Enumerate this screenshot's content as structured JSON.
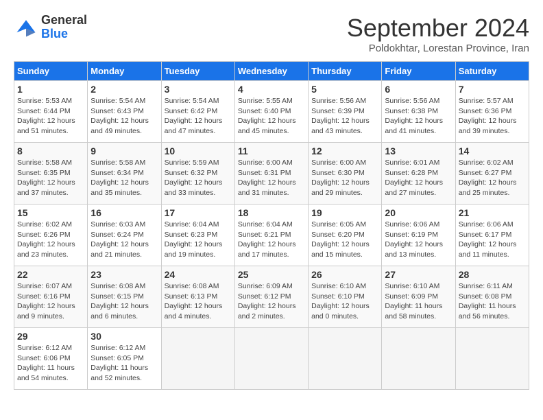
{
  "logo": {
    "text_general": "General",
    "text_blue": "Blue"
  },
  "header": {
    "month": "September 2024",
    "location": "Poldokhtar, Lorestan Province, Iran"
  },
  "weekdays": [
    "Sunday",
    "Monday",
    "Tuesday",
    "Wednesday",
    "Thursday",
    "Friday",
    "Saturday"
  ],
  "weeks": [
    [
      {
        "day": "1",
        "sunrise": "5:53 AM",
        "sunset": "6:44 PM",
        "daylight": "12 hours and 51 minutes."
      },
      {
        "day": "2",
        "sunrise": "5:54 AM",
        "sunset": "6:43 PM",
        "daylight": "12 hours and 49 minutes."
      },
      {
        "day": "3",
        "sunrise": "5:54 AM",
        "sunset": "6:42 PM",
        "daylight": "12 hours and 47 minutes."
      },
      {
        "day": "4",
        "sunrise": "5:55 AM",
        "sunset": "6:40 PM",
        "daylight": "12 hours and 45 minutes."
      },
      {
        "day": "5",
        "sunrise": "5:56 AM",
        "sunset": "6:39 PM",
        "daylight": "12 hours and 43 minutes."
      },
      {
        "day": "6",
        "sunrise": "5:56 AM",
        "sunset": "6:38 PM",
        "daylight": "12 hours and 41 minutes."
      },
      {
        "day": "7",
        "sunrise": "5:57 AM",
        "sunset": "6:36 PM",
        "daylight": "12 hours and 39 minutes."
      }
    ],
    [
      {
        "day": "8",
        "sunrise": "5:58 AM",
        "sunset": "6:35 PM",
        "daylight": "12 hours and 37 minutes."
      },
      {
        "day": "9",
        "sunrise": "5:58 AM",
        "sunset": "6:34 PM",
        "daylight": "12 hours and 35 minutes."
      },
      {
        "day": "10",
        "sunrise": "5:59 AM",
        "sunset": "6:32 PM",
        "daylight": "12 hours and 33 minutes."
      },
      {
        "day": "11",
        "sunrise": "6:00 AM",
        "sunset": "6:31 PM",
        "daylight": "12 hours and 31 minutes."
      },
      {
        "day": "12",
        "sunrise": "6:00 AM",
        "sunset": "6:30 PM",
        "daylight": "12 hours and 29 minutes."
      },
      {
        "day": "13",
        "sunrise": "6:01 AM",
        "sunset": "6:28 PM",
        "daylight": "12 hours and 27 minutes."
      },
      {
        "day": "14",
        "sunrise": "6:02 AM",
        "sunset": "6:27 PM",
        "daylight": "12 hours and 25 minutes."
      }
    ],
    [
      {
        "day": "15",
        "sunrise": "6:02 AM",
        "sunset": "6:26 PM",
        "daylight": "12 hours and 23 minutes."
      },
      {
        "day": "16",
        "sunrise": "6:03 AM",
        "sunset": "6:24 PM",
        "daylight": "12 hours and 21 minutes."
      },
      {
        "day": "17",
        "sunrise": "6:04 AM",
        "sunset": "6:23 PM",
        "daylight": "12 hours and 19 minutes."
      },
      {
        "day": "18",
        "sunrise": "6:04 AM",
        "sunset": "6:21 PM",
        "daylight": "12 hours and 17 minutes."
      },
      {
        "day": "19",
        "sunrise": "6:05 AM",
        "sunset": "6:20 PM",
        "daylight": "12 hours and 15 minutes."
      },
      {
        "day": "20",
        "sunrise": "6:06 AM",
        "sunset": "6:19 PM",
        "daylight": "12 hours and 13 minutes."
      },
      {
        "day": "21",
        "sunrise": "6:06 AM",
        "sunset": "6:17 PM",
        "daylight": "12 hours and 11 minutes."
      }
    ],
    [
      {
        "day": "22",
        "sunrise": "6:07 AM",
        "sunset": "6:16 PM",
        "daylight": "12 hours and 9 minutes."
      },
      {
        "day": "23",
        "sunrise": "6:08 AM",
        "sunset": "6:15 PM",
        "daylight": "12 hours and 6 minutes."
      },
      {
        "day": "24",
        "sunrise": "6:08 AM",
        "sunset": "6:13 PM",
        "daylight": "12 hours and 4 minutes."
      },
      {
        "day": "25",
        "sunrise": "6:09 AM",
        "sunset": "6:12 PM",
        "daylight": "12 hours and 2 minutes."
      },
      {
        "day": "26",
        "sunrise": "6:10 AM",
        "sunset": "6:10 PM",
        "daylight": "12 hours and 0 minutes."
      },
      {
        "day": "27",
        "sunrise": "6:10 AM",
        "sunset": "6:09 PM",
        "daylight": "11 hours and 58 minutes."
      },
      {
        "day": "28",
        "sunrise": "6:11 AM",
        "sunset": "6:08 PM",
        "daylight": "11 hours and 56 minutes."
      }
    ],
    [
      {
        "day": "29",
        "sunrise": "6:12 AM",
        "sunset": "6:06 PM",
        "daylight": "11 hours and 54 minutes."
      },
      {
        "day": "30",
        "sunrise": "6:12 AM",
        "sunset": "6:05 PM",
        "daylight": "11 hours and 52 minutes."
      },
      null,
      null,
      null,
      null,
      null
    ]
  ]
}
